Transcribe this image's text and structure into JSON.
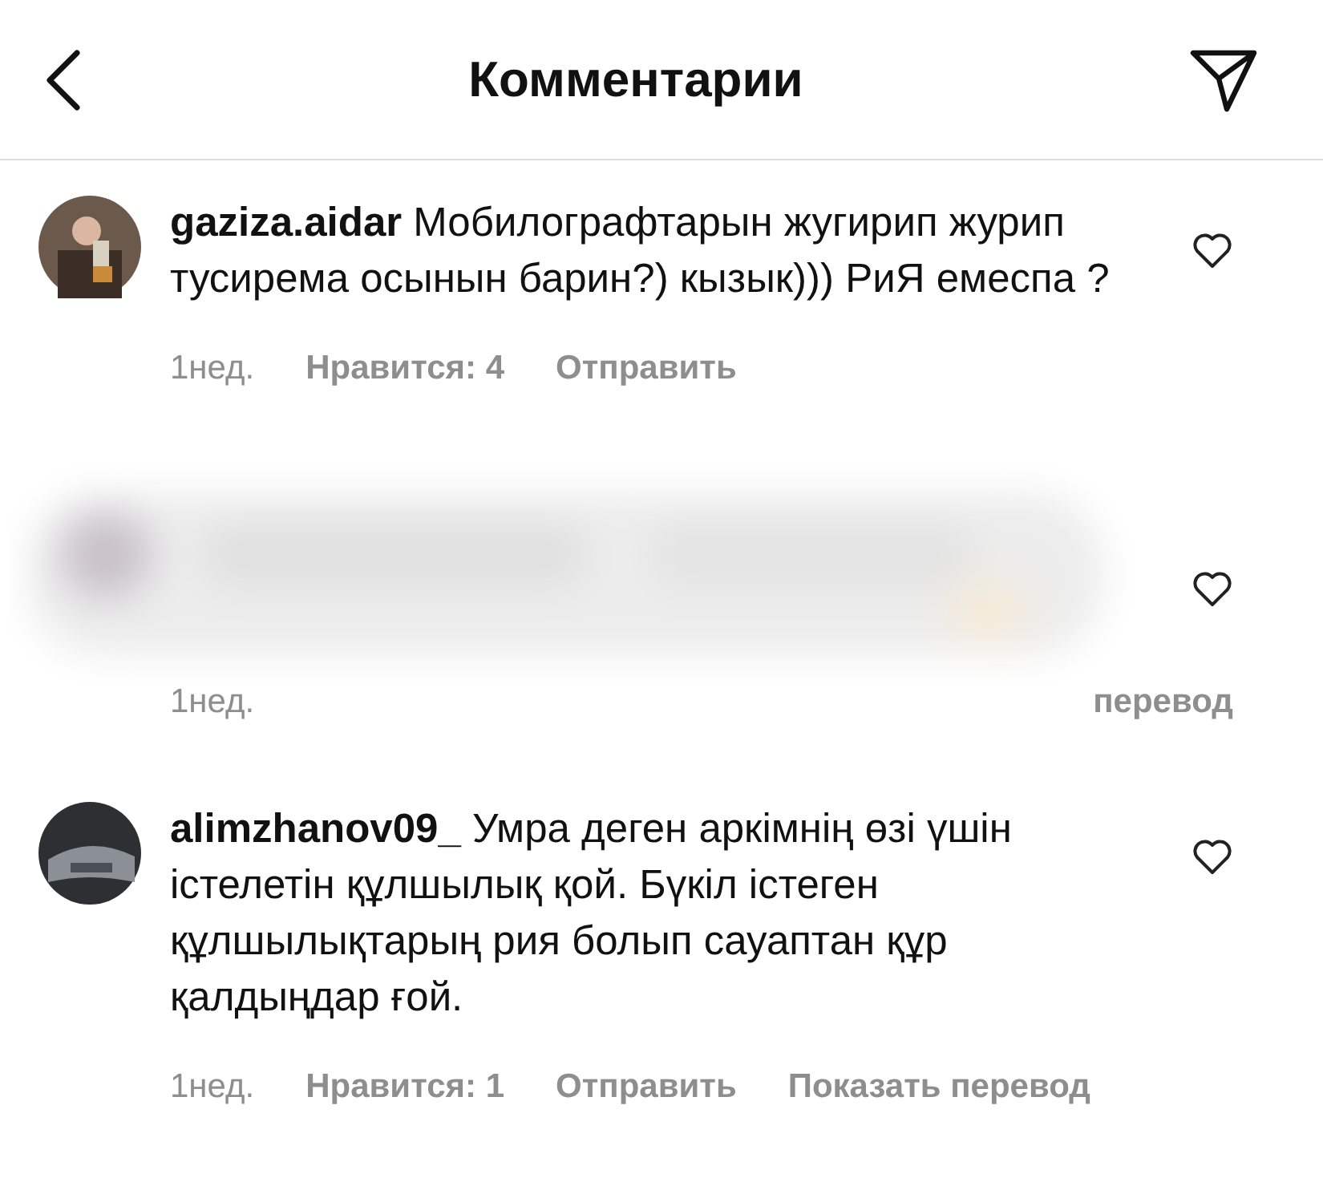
{
  "header": {
    "title": "Комментарии"
  },
  "comments": [
    {
      "kind": "normal",
      "username": "gaziza.aidar",
      "text": "Мобилографтарын жугирип журип тусирема осынын барин?) кызык))) РиЯ емеспа ?",
      "time": "1нед.",
      "likes": "Нравится: 4",
      "reply": "Отправить",
      "liked": false
    },
    {
      "kind": "blurred",
      "time": "1нед.",
      "translate": "перевод",
      "liked": false
    },
    {
      "kind": "normal",
      "username": "alimzhanov09_",
      "text": "Умра деген аркімнің өзі үшін істелетін құлшылық қой. Бүкіл істеген құлшылықтарың рия болып сауаптан құр қалдыңдар ғой.",
      "time": "1нед.",
      "likes": "Нравится: 1",
      "reply": "Отправить",
      "translate": "Показать перевод",
      "liked": false
    }
  ]
}
